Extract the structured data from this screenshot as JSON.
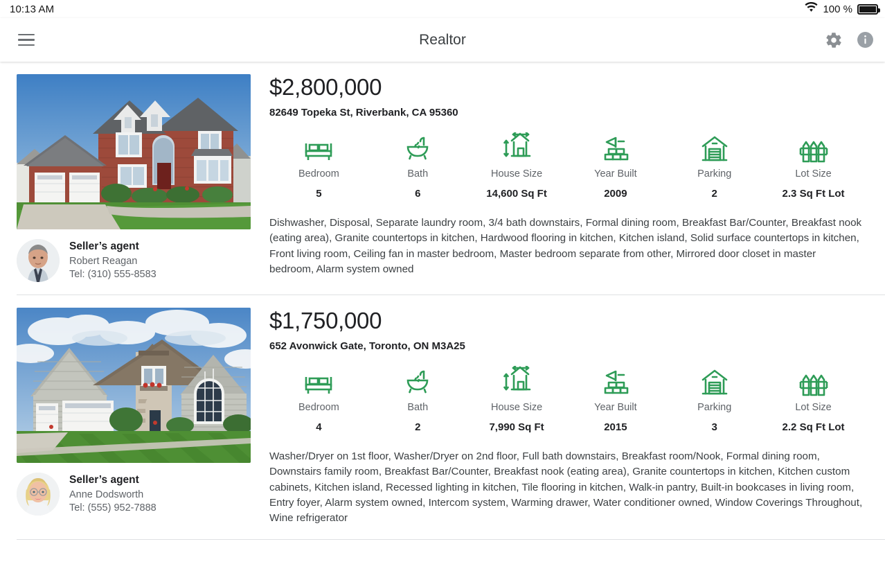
{
  "statusbar": {
    "time": "10:13 AM",
    "battery_percent": "100 %",
    "wifi_icon": "wifi-icon",
    "battery_icon": "battery-full-icon"
  },
  "appbar": {
    "title": "Realtor",
    "menu_icon": "hamburger-menu-icon",
    "settings_icon": "gear-icon",
    "info_icon": "info-icon"
  },
  "colors": {
    "accent_green": "#2e9c57",
    "text_primary": "#202124",
    "text_secondary": "#5f6368",
    "divider": "#dfe1e3"
  },
  "spec_labels": {
    "bedroom": "Bedroom",
    "bath": "Bath",
    "house_size": "House Size",
    "year_built": "Year Built",
    "parking": "Parking",
    "lot_size": "Lot Size"
  },
  "agent_role_label": "Seller’s agent",
  "listings": [
    {
      "price": "$2,800,000",
      "address": "82649 Topeka St, Riverbank, CA 95360",
      "specs": [
        {
          "label": "Bedroom",
          "value": "5",
          "icon": "bed-icon"
        },
        {
          "label": "Bath",
          "value": "6",
          "icon": "bathtub-shower-icon"
        },
        {
          "label": "House Size",
          "value": "14,600 Sq Ft",
          "icon": "house-dimensions-icon"
        },
        {
          "label": "Year Built",
          "value": "2009",
          "icon": "bricks-flag-icon"
        },
        {
          "label": "Parking",
          "value": "2",
          "icon": "garage-icon"
        },
        {
          "label": "Lot Size",
          "value": "2.3 Sq Ft Lot",
          "icon": "fence-icon"
        }
      ],
      "description": "Dishwasher, Disposal, Separate laundry room, 3/4 bath downstairs, Formal dining room, Breakfast Bar/Counter, Breakfast nook (eating area), Granite countertops in kitchen, Hardwood flooring in kitchen, Kitchen island, Solid surface countertops in kitchen, Front living room, Ceiling fan in master bedroom, Master bedroom separate from other, Mirrored door closet in master bedroom, Alarm system owned",
      "agent": {
        "role": "Seller’s agent",
        "name": "Robert Reagan",
        "tel": "Tel: (310) 555-8583"
      },
      "photo_alt": "brick-two-story-house-photo"
    },
    {
      "price": "$1,750,000",
      "address": "652 Avonwick Gate, Toronto, ON M3A25",
      "specs": [
        {
          "label": "Bedroom",
          "value": "4",
          "icon": "bed-icon"
        },
        {
          "label": "Bath",
          "value": "2",
          "icon": "bathtub-shower-icon"
        },
        {
          "label": "House Size",
          "value": "7,990 Sq Ft",
          "icon": "house-dimensions-icon"
        },
        {
          "label": "Year Built",
          "value": "2015",
          "icon": "bricks-flag-icon"
        },
        {
          "label": "Parking",
          "value": "3",
          "icon": "garage-icon"
        },
        {
          "label": "Lot Size",
          "value": "2.2 Sq Ft Lot",
          "icon": "fence-icon"
        }
      ],
      "description": "Washer/Dryer on 1st floor, Washer/Dryer on 2nd floor, Full bath downstairs, Breakfast room/Nook, Formal dining room, Downstairs family room, Breakfast Bar/Counter, Breakfast nook (eating area), Granite countertops in kitchen, Kitchen custom cabinets, Kitchen island, Recessed lighting in kitchen, Tile flooring in kitchen, Walk-in pantry, Built-in bookcases in living room, Entry foyer, Alarm system owned, Intercom system, Warming drawer, Water conditioner owned, Window Coverings Throughout, Wine refrigerator",
      "agent": {
        "role": "Seller’s agent",
        "name": "Anne Dodsworth",
        "tel": "Tel: (555) 952-7888"
      },
      "photo_alt": "gray-siding-house-photo"
    }
  ]
}
